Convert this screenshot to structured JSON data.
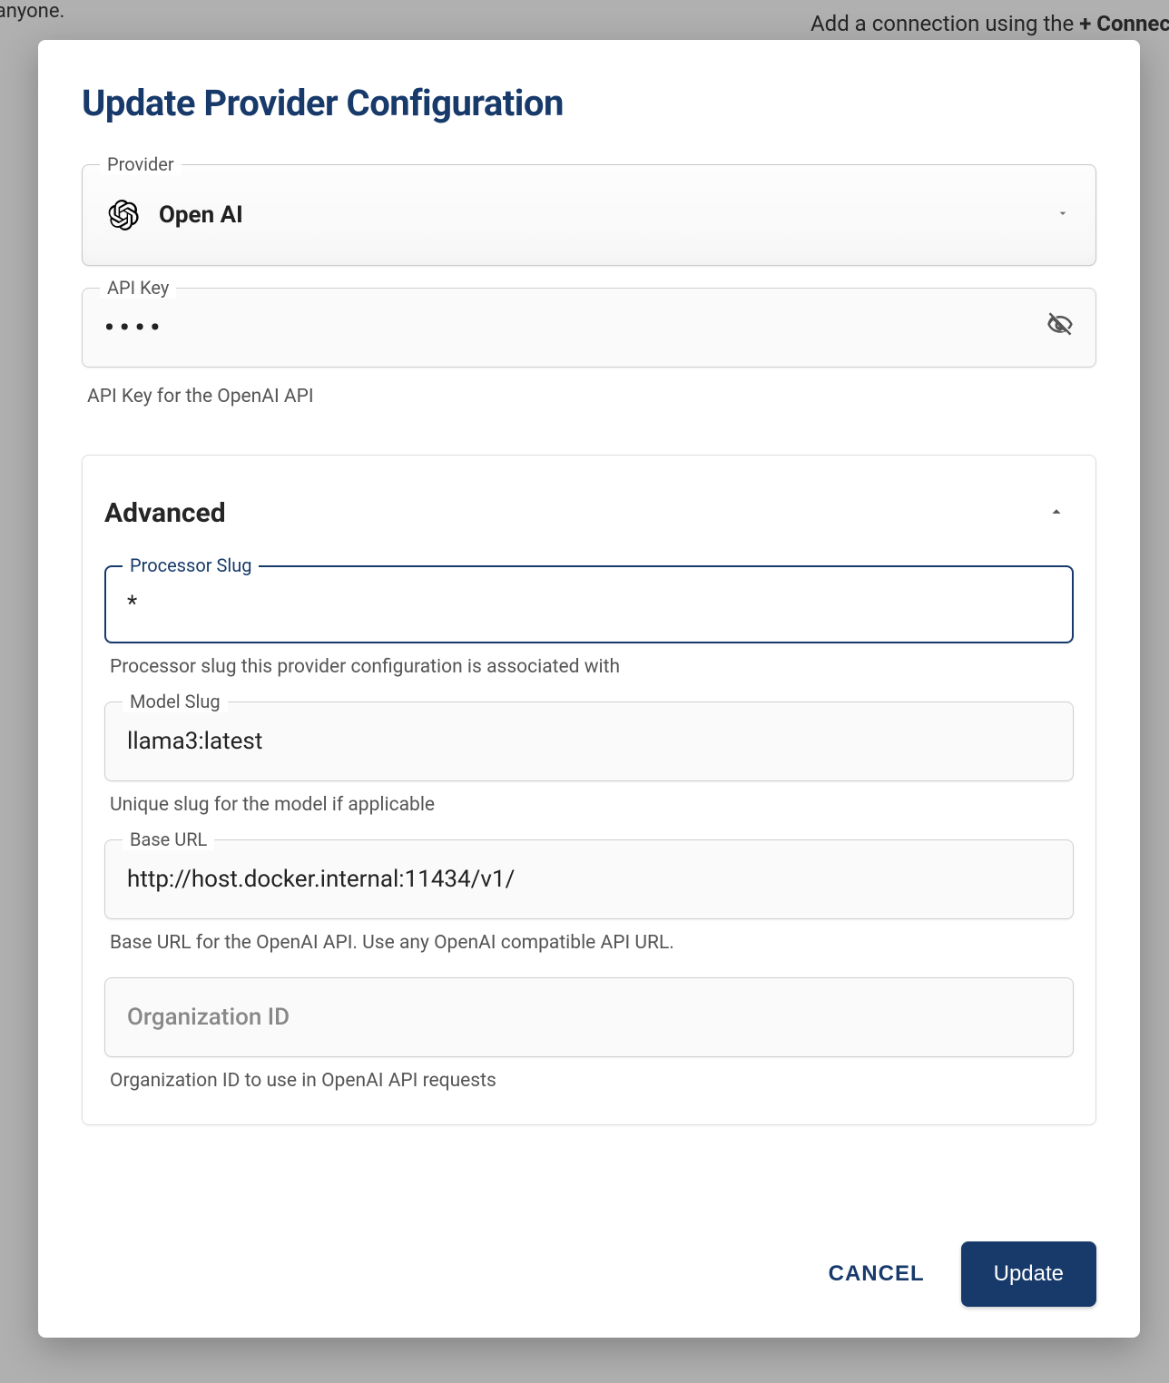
{
  "background": {
    "snippet_left": "th anyone.",
    "snippet_right_prefix": "Add a connection using the ",
    "snippet_right_bold": "+ Connect"
  },
  "modal": {
    "title": "Update Provider Configuration",
    "provider": {
      "label": "Provider",
      "selected": "Open AI"
    },
    "api_key": {
      "label": "API Key",
      "masked_value": "••••",
      "helper": "API Key for the OpenAI API"
    },
    "advanced": {
      "title": "Advanced",
      "expanded": true,
      "processor_slug": {
        "label": "Processor Slug",
        "value": "*",
        "helper": "Processor slug this provider configuration is associated with"
      },
      "model_slug": {
        "label": "Model Slug",
        "value": "llama3:latest",
        "helper": "Unique slug for the model if applicable"
      },
      "base_url": {
        "label": "Base URL",
        "value": "http://host.docker.internal:11434/v1/",
        "helper": "Base URL for the OpenAI API. Use any OpenAI compatible API URL."
      },
      "organization_id": {
        "placeholder": "Organization ID",
        "value": "",
        "helper": "Organization ID to use in OpenAI API requests"
      }
    },
    "buttons": {
      "cancel": "CANCEL",
      "update": "Update"
    }
  }
}
